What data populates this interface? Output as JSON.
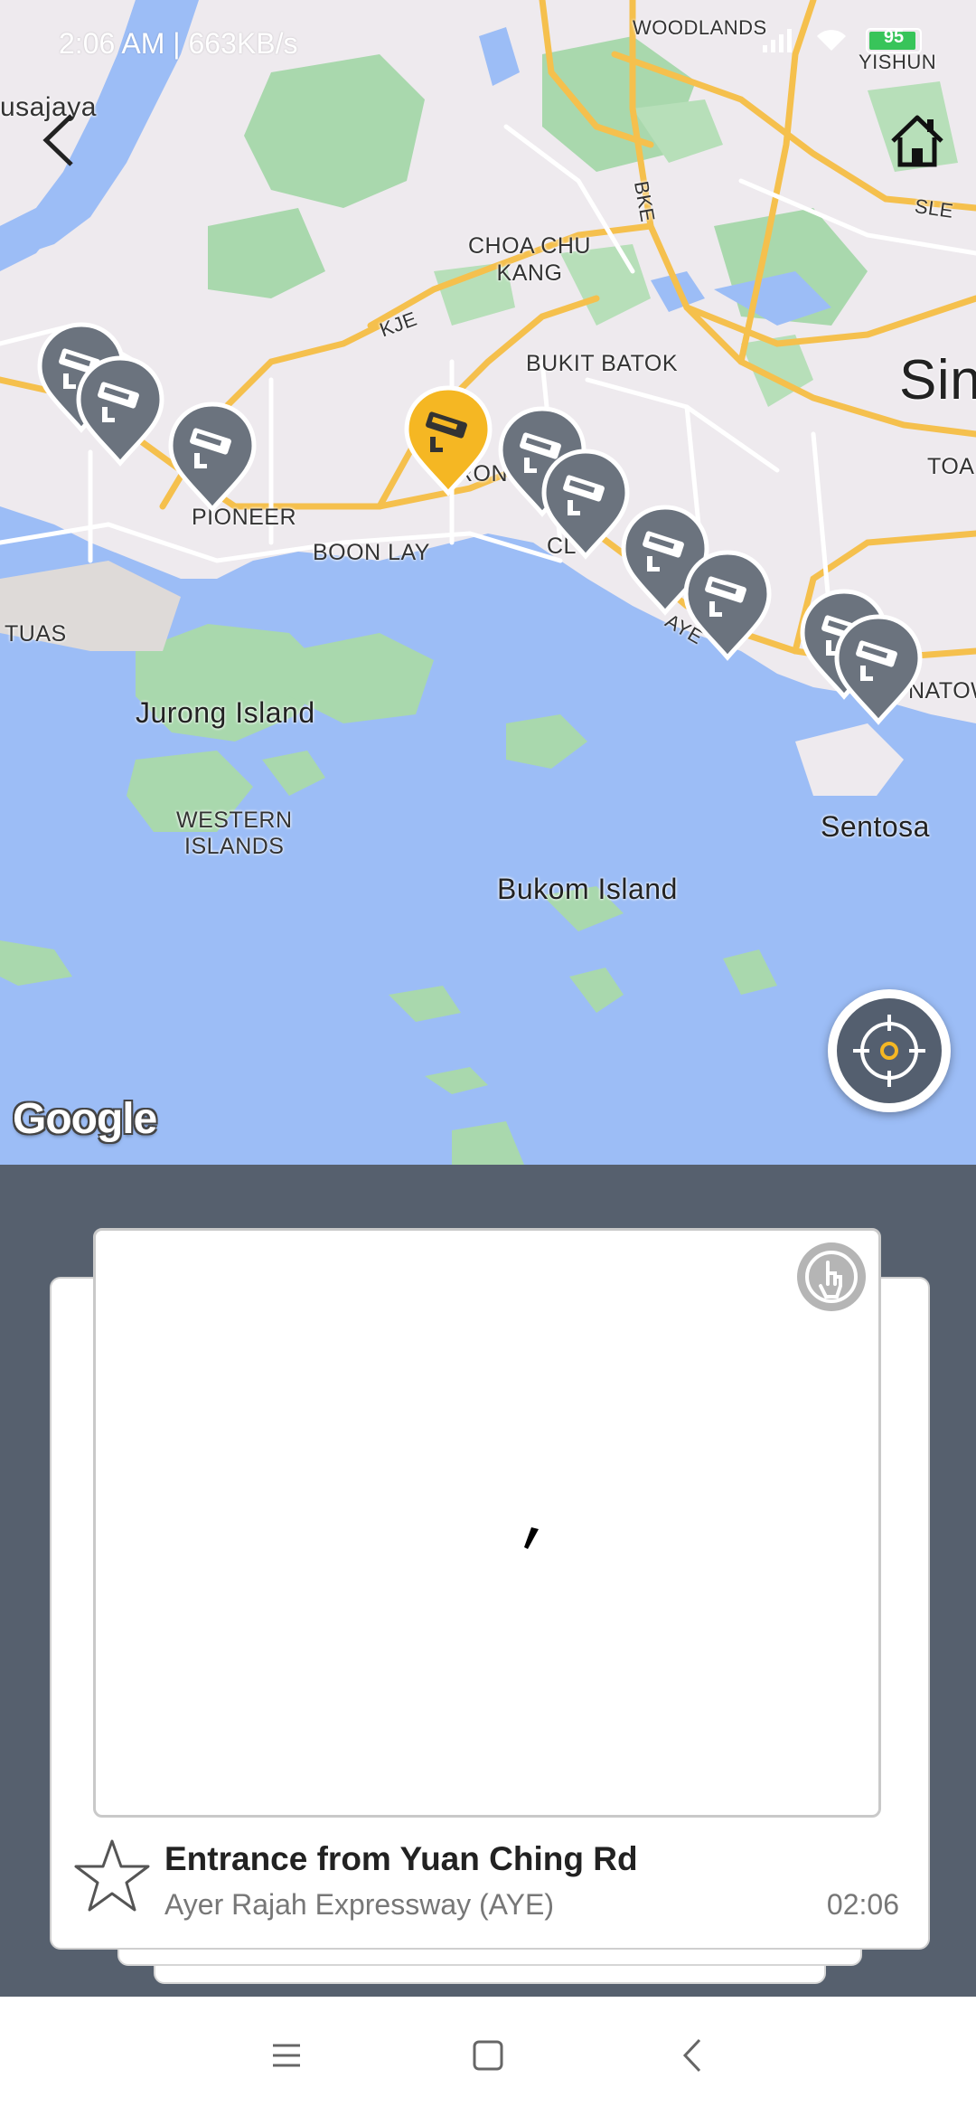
{
  "status_bar": {
    "time": "2:06 AM | 663KB/s",
    "battery": "95",
    "battery_level": 0.95
  },
  "map": {
    "labels": {
      "usajaya": "usajaya",
      "woodlands": "WOODLANDS",
      "yishun": "YISHUN",
      "sle": "SLE",
      "bke": "BKE",
      "choa_chu_kang": "CHOA CHU\nKANG",
      "kje": "KJE",
      "bukit_batok": "BUKIT BATOK",
      "sin": "Sin",
      "toa": "TOA",
      "pioneer": "PIONEER",
      "boon_lay": "BOON LAY",
      "tuas": "TUAS",
      "jurong_island": "Jurong Island",
      "aye": "AYE",
      "natow": "NATOW",
      "western_islands": "WESTERN\nISLANDS",
      "sentosa": "Sentosa",
      "bukom_island": "Bukom Island",
      "ron": "RON",
      "cl": "CL"
    },
    "google": "Google",
    "accent_selected": "#f5b723",
    "pin_color": "#6b737e"
  },
  "camera": {
    "title": "Entrance from Yuan Ching Rd",
    "road": "Ayer Rajah Expressway (AYE)",
    "time": "02:06"
  },
  "icons": {
    "back": "back-arrow-icon",
    "home": "home-icon",
    "locate": "crosshair-icon",
    "touch": "touch-hand-icon",
    "favorite": "star-outline-icon",
    "camera": "cctv-camera-icon"
  }
}
